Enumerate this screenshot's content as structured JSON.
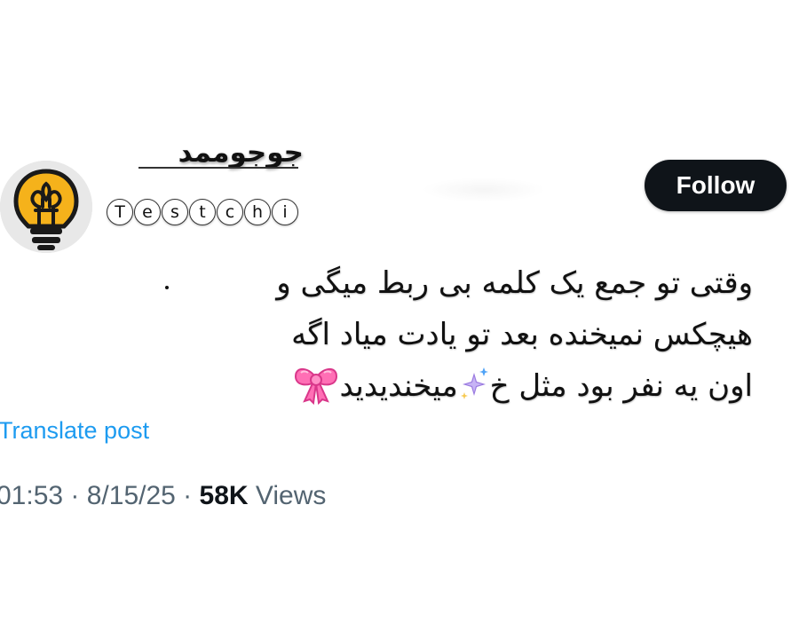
{
  "author": {
    "display_name": "جوجوممد",
    "handle_letters": [
      "T",
      "e",
      "s",
      "t",
      "c",
      "h",
      "i"
    ],
    "avatar_icon": "lightbulb-icon"
  },
  "follow_button": {
    "label": "Follow"
  },
  "tweet": {
    "lines": [
      "وقتی تو جمع یک کلمه بی ربط میگی و",
      "هیچکس نمیخنده بعد تو یادت میاد اگه",
      "اون یه نفر بود مثل خ"
    ],
    "line3_suffix": "میخندیدید",
    "emojis": [
      "sparkles-icon",
      "ribbon-bow-icon"
    ]
  },
  "translate": {
    "label": "Translate post"
  },
  "meta": {
    "time": "01:53",
    "separator": " · ",
    "date": "8/15/25",
    "views_count": "58K",
    "views_label": " Views"
  },
  "colors": {
    "link": "#1d9bf0",
    "meta_text": "#536471",
    "button_bg": "#0f1419",
    "avatar_bulb": "#f5b21b"
  }
}
